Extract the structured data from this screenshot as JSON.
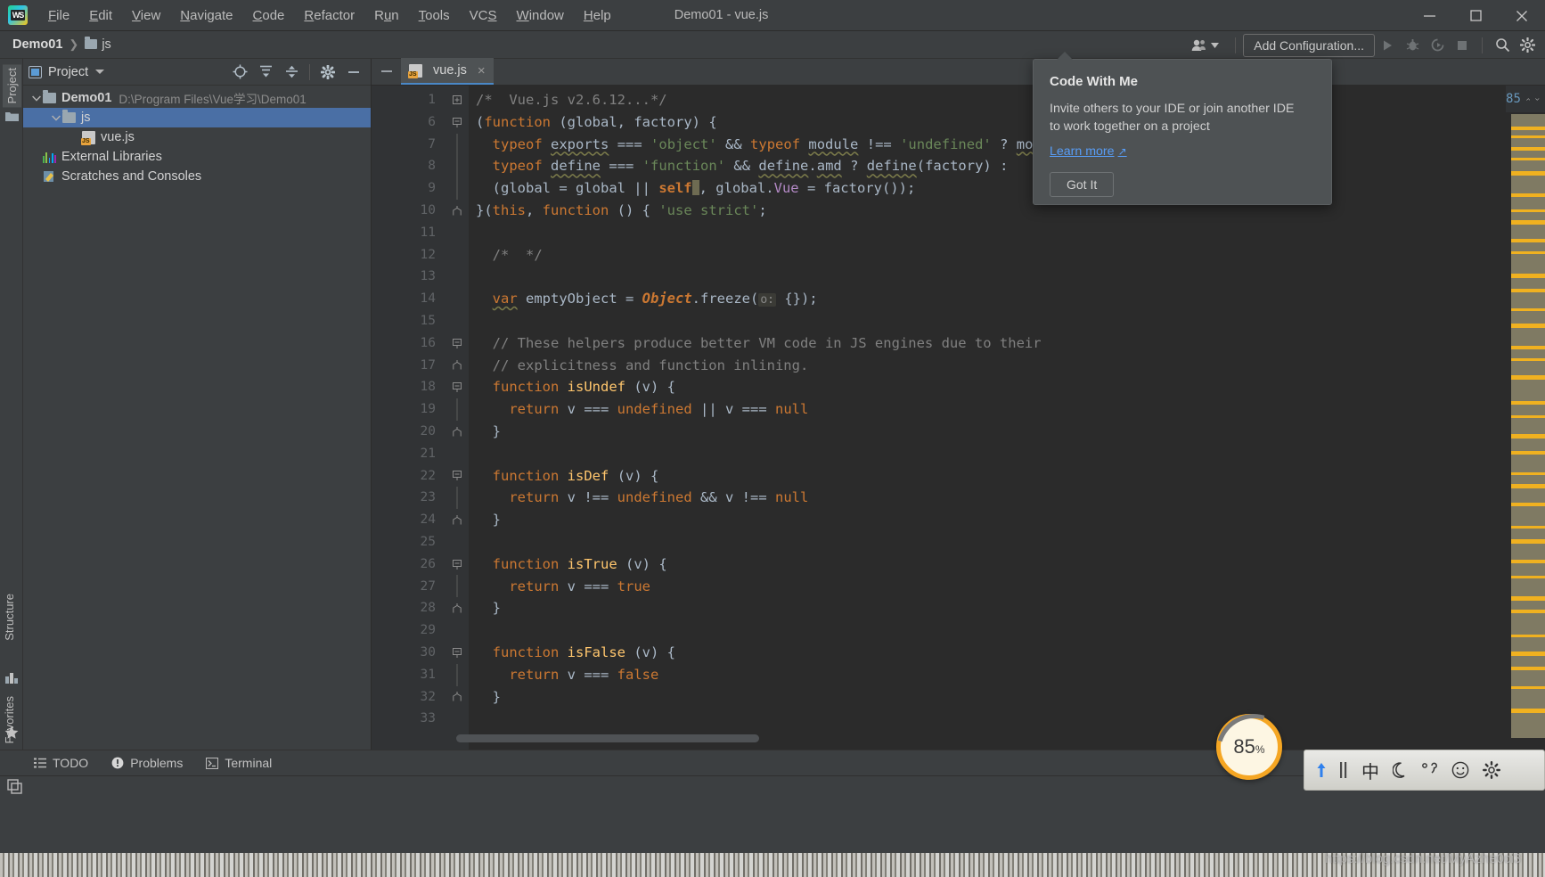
{
  "window": {
    "title": "Demo01 - vue.js",
    "app_logo": "WS",
    "controls": {
      "minimize": "minimize-icon",
      "maximize": "maximize-icon",
      "close": "close-icon"
    }
  },
  "menu": {
    "items": [
      {
        "label": "File",
        "mnemonic": "F"
      },
      {
        "label": "Edit",
        "mnemonic": "E"
      },
      {
        "label": "View",
        "mnemonic": "V"
      },
      {
        "label": "Navigate",
        "mnemonic": "N"
      },
      {
        "label": "Code",
        "mnemonic": "C"
      },
      {
        "label": "Refactor",
        "mnemonic": "R"
      },
      {
        "label": "Run",
        "mnemonic": "u"
      },
      {
        "label": "Tools",
        "mnemonic": "T"
      },
      {
        "label": "VCS",
        "mnemonic": "S"
      },
      {
        "label": "Window",
        "mnemonic": "W"
      },
      {
        "label": "Help",
        "mnemonic": "H"
      }
    ]
  },
  "navbar": {
    "breadcrumbs": [
      {
        "label": "Demo01"
      },
      {
        "label": "js"
      }
    ],
    "add_configuration_label": "Add Configuration...",
    "icons": [
      "code-with-me-icon",
      "run-icon",
      "debug-icon",
      "run-coverage-icon",
      "stop-icon",
      "search-icon",
      "settings-icon"
    ]
  },
  "toolstrip": {
    "left_tabs": [
      {
        "label": "Project",
        "icon": "project-folder-icon",
        "active": true
      },
      {
        "label": "Structure",
        "icon": "structure-icon",
        "active": false
      },
      {
        "label": "Favorites",
        "icon": "star-icon",
        "active": false
      }
    ]
  },
  "project_panel": {
    "title": "Project",
    "actions": [
      "locate-icon",
      "expand-all-icon",
      "collapse-all-icon",
      "settings-icon",
      "hide-icon"
    ],
    "tree": [
      {
        "label": "Demo01",
        "path": "D:\\Program Files\\Vue学习\\Demo01",
        "icon": "folder-icon",
        "indent": 0,
        "expanded": true,
        "selected": false,
        "bold": true
      },
      {
        "label": "js",
        "path": "",
        "icon": "folder-icon",
        "indent": 1,
        "expanded": true,
        "selected": true,
        "bold": false
      },
      {
        "label": "vue.js",
        "path": "",
        "icon": "js-file-icon",
        "indent": 2,
        "expanded": null,
        "selected": false,
        "bold": false
      },
      {
        "label": "External Libraries",
        "path": "",
        "icon": "library-icon",
        "indent": 0,
        "expanded": null,
        "selected": false,
        "bold": false
      },
      {
        "label": "Scratches and Consoles",
        "path": "",
        "icon": "scratches-icon",
        "indent": 0,
        "expanded": null,
        "selected": false,
        "bold": false
      }
    ]
  },
  "editor": {
    "tabs": [
      {
        "label": "vue.js",
        "icon": "js-file-icon",
        "active": true,
        "close": "×"
      }
    ],
    "inspection_count": "85",
    "lines": [
      {
        "num": "1",
        "fold": "plus",
        "html": "<span class=\"c\">/*  Vue.js v2.6.12...*/</span>"
      },
      {
        "num": "6",
        "fold": "open",
        "html": "<span class=\"n\">(</span><span class=\"k\">function</span> <span class=\"n\">(global, factory) {</span>"
      },
      {
        "num": "7",
        "fold": "bar",
        "html": "  <span class=\"k\">typeof</span> <span class=\"n wavy\">exports</span> <span class=\"n\">===</span> <span class=\"s\">'object'</span> <span class=\"n\">&amp;&amp;</span> <span class=\"k\">typeof</span> <span class=\"n wavy\">module</span> <span class=\"n\">!==</span> <span class=\"s\">'undefined'</span> <span class=\"n\">?</span> <span class=\"n wavy\">module</span>"
      },
      {
        "num": "8",
        "fold": "bar",
        "html": "  <span class=\"k\">typeof</span> <span class=\"n wavy\">define</span> <span class=\"n\">===</span> <span class=\"s\">'function'</span> <span class=\"n\">&amp;&amp;</span> <span class=\"n wavy\">define</span><span class=\"n\">.</span><span class=\"n wavy\">amd</span> <span class=\"n\">?</span> <span class=\"n wavy\">define</span><span class=\"n\">(factory) :</span>"
      },
      {
        "num": "9",
        "fold": "bar",
        "html": "  <span class=\"n\">(global = global || </span><span class=\"kw\">self</span><span class=\"caretblk\"></span><span class=\"n\">, global.</span><span class=\"vue\">Vue</span><span class=\"n\"> = factory());</span>"
      },
      {
        "num": "10",
        "fold": "close",
        "html": "<span class=\"n\">}(</span><span class=\"k\">this</span><span class=\"n\">, </span><span class=\"k\">function</span> <span class=\"n\">() { </span><span class=\"s\">'use strict'</span><span class=\"n\">;</span>"
      },
      {
        "num": "11",
        "fold": "",
        "html": ""
      },
      {
        "num": "12",
        "fold": "",
        "html": "  <span class=\"c\">/*  */</span>"
      },
      {
        "num": "13",
        "fold": "",
        "html": ""
      },
      {
        "num": "14",
        "fold": "",
        "html": "  <span class=\"k wavy\">var</span> <span class=\"n\">emptyObject = </span><span class=\"cls\">Object</span><span class=\"n\">.freeze(</span><span class=\"hint\">o:</span><span class=\"n\"> {});</span>"
      },
      {
        "num": "15",
        "fold": "",
        "html": ""
      },
      {
        "num": "16",
        "fold": "open",
        "html": "  <span class=\"c\">// These helpers produce better VM code in JS engines due to their</span>"
      },
      {
        "num": "17",
        "fold": "close",
        "html": "  <span class=\"c\">// explicitness and function inlining.</span>"
      },
      {
        "num": "18",
        "fold": "open",
        "html": "  <span class=\"k\">function</span> <span class=\"f\">isUndef</span> <span class=\"n\">(v) {</span>"
      },
      {
        "num": "19",
        "fold": "bar",
        "html": "    <span class=\"k\">return</span> <span class=\"n\">v === </span><span class=\"k\">undefined</span><span class=\"n\"> || v === </span><span class=\"k\">null</span>"
      },
      {
        "num": "20",
        "fold": "close",
        "html": "  <span class=\"n\">}</span>"
      },
      {
        "num": "21",
        "fold": "",
        "html": ""
      },
      {
        "num": "22",
        "fold": "open",
        "html": "  <span class=\"k\">function</span> <span class=\"f\">isDef</span> <span class=\"n\">(v) {</span>"
      },
      {
        "num": "23",
        "fold": "bar",
        "html": "    <span class=\"k\">return</span> <span class=\"n\">v !== </span><span class=\"k\">undefined</span><span class=\"n\"> &amp;&amp; v !== </span><span class=\"k\">null</span>"
      },
      {
        "num": "24",
        "fold": "close",
        "html": "  <span class=\"n\">}</span>"
      },
      {
        "num": "25",
        "fold": "",
        "html": ""
      },
      {
        "num": "26",
        "fold": "open",
        "html": "  <span class=\"k\">function</span> <span class=\"f\">isTrue</span> <span class=\"n\">(v) {</span>"
      },
      {
        "num": "27",
        "fold": "bar",
        "html": "    <span class=\"k\">return</span> <span class=\"n\">v === </span><span class=\"k\">true</span>"
      },
      {
        "num": "28",
        "fold": "close",
        "html": "  <span class=\"n\">}</span>"
      },
      {
        "num": "29",
        "fold": "",
        "html": ""
      },
      {
        "num": "30",
        "fold": "open",
        "html": "  <span class=\"k\">function</span> <span class=\"f\">isFalse</span> <span class=\"n\">(v) {</span>"
      },
      {
        "num": "31",
        "fold": "bar",
        "html": "    <span class=\"k\">return</span> <span class=\"n\">v === </span><span class=\"k\">false</span>"
      },
      {
        "num": "32",
        "fold": "close",
        "html": "  <span class=\"n\">}</span>"
      },
      {
        "num": "33",
        "fold": "",
        "html": ""
      }
    ]
  },
  "code_with_me_popup": {
    "title": "Code With Me",
    "body_line1": "Invite others to your IDE or join another IDE",
    "body_line2": "to work together on a project",
    "link_label": "Learn more",
    "link_arrow": "↗",
    "button_label": "Got It"
  },
  "bottom_bar": {
    "items": [
      {
        "label": "TODO",
        "icon": "list-icon"
      },
      {
        "label": "Problems",
        "icon": "warning-icon"
      },
      {
        "label": "Terminal",
        "icon": "terminal-icon"
      }
    ]
  },
  "status_bar": {
    "icon": "layout-icon"
  },
  "system_tray": {
    "battery_percent": "85",
    "battery_unit": "%",
    "ime_icons": [
      "upload-arrow-icon",
      "pause-bars-icon",
      "chinese-mode-icon",
      "moon-icon",
      "punctuation-icon",
      "emoji-icon",
      "settings-icon"
    ],
    "chinese_mode_glyph": "中"
  },
  "watermark": {
    "text": "https://blog.csdn.net/MyAzhe0ci3"
  },
  "colors": {
    "accent": "#4a88c7",
    "selection": "#4a6fa5",
    "editor_bg": "#2b2b2b",
    "panel_bg": "#3c3f41",
    "gutter_bg": "#313335",
    "link": "#589df6",
    "warning_stripe": "#f0b120"
  }
}
